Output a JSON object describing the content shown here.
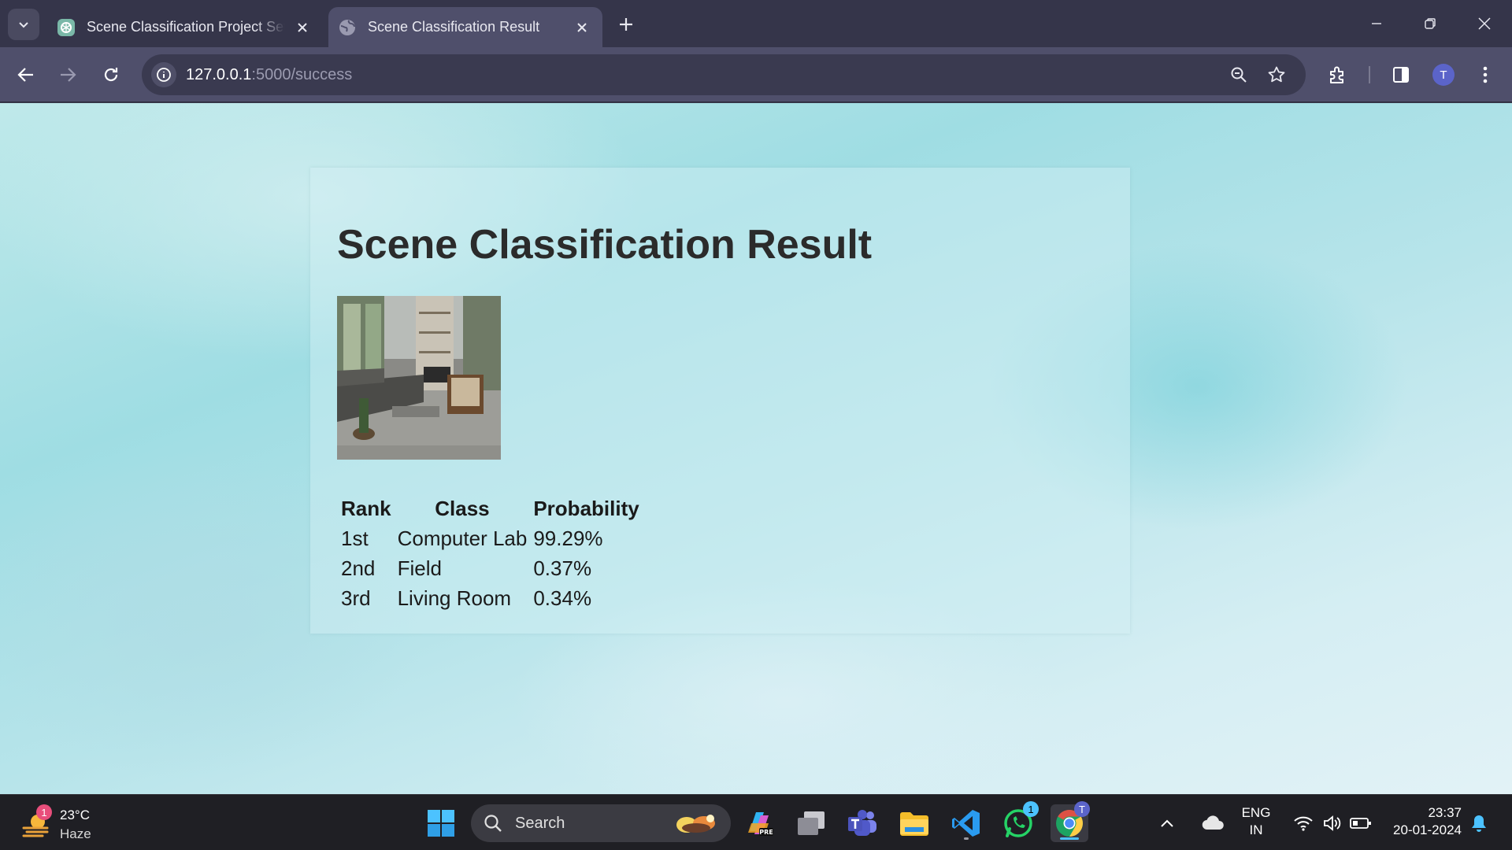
{
  "browser": {
    "tabs": [
      {
        "title": "Scene Classification Project Setup",
        "active": false
      },
      {
        "title": "Scene Classification Result",
        "active": true
      }
    ],
    "url": {
      "host": "127.0.0.1",
      "rest": ":5000/success"
    },
    "profile_initial": "T",
    "accent": "#5b64c9"
  },
  "page": {
    "title": "Scene Classification Result",
    "image": {
      "subject": "living room scene"
    },
    "table": {
      "headers": [
        "Rank",
        "Class",
        "Probability"
      ],
      "rows": [
        {
          "rank": "1st",
          "class": "Computer Lab",
          "probability": "99.29%"
        },
        {
          "rank": "2nd",
          "class": "Field",
          "probability": "0.37%"
        },
        {
          "rank": "3rd",
          "class": "Living Room",
          "probability": "0.34%"
        }
      ]
    }
  },
  "taskbar": {
    "weather": {
      "temp": "23°C",
      "condition": "Haze",
      "badge": "1"
    },
    "search_label": "Search",
    "whatsapp_badge": "1",
    "chrome_badge": "T",
    "language": {
      "line1": "ENG",
      "line2": "IN"
    },
    "clock": {
      "time": "23:37",
      "date": "20-01-2024"
    }
  }
}
